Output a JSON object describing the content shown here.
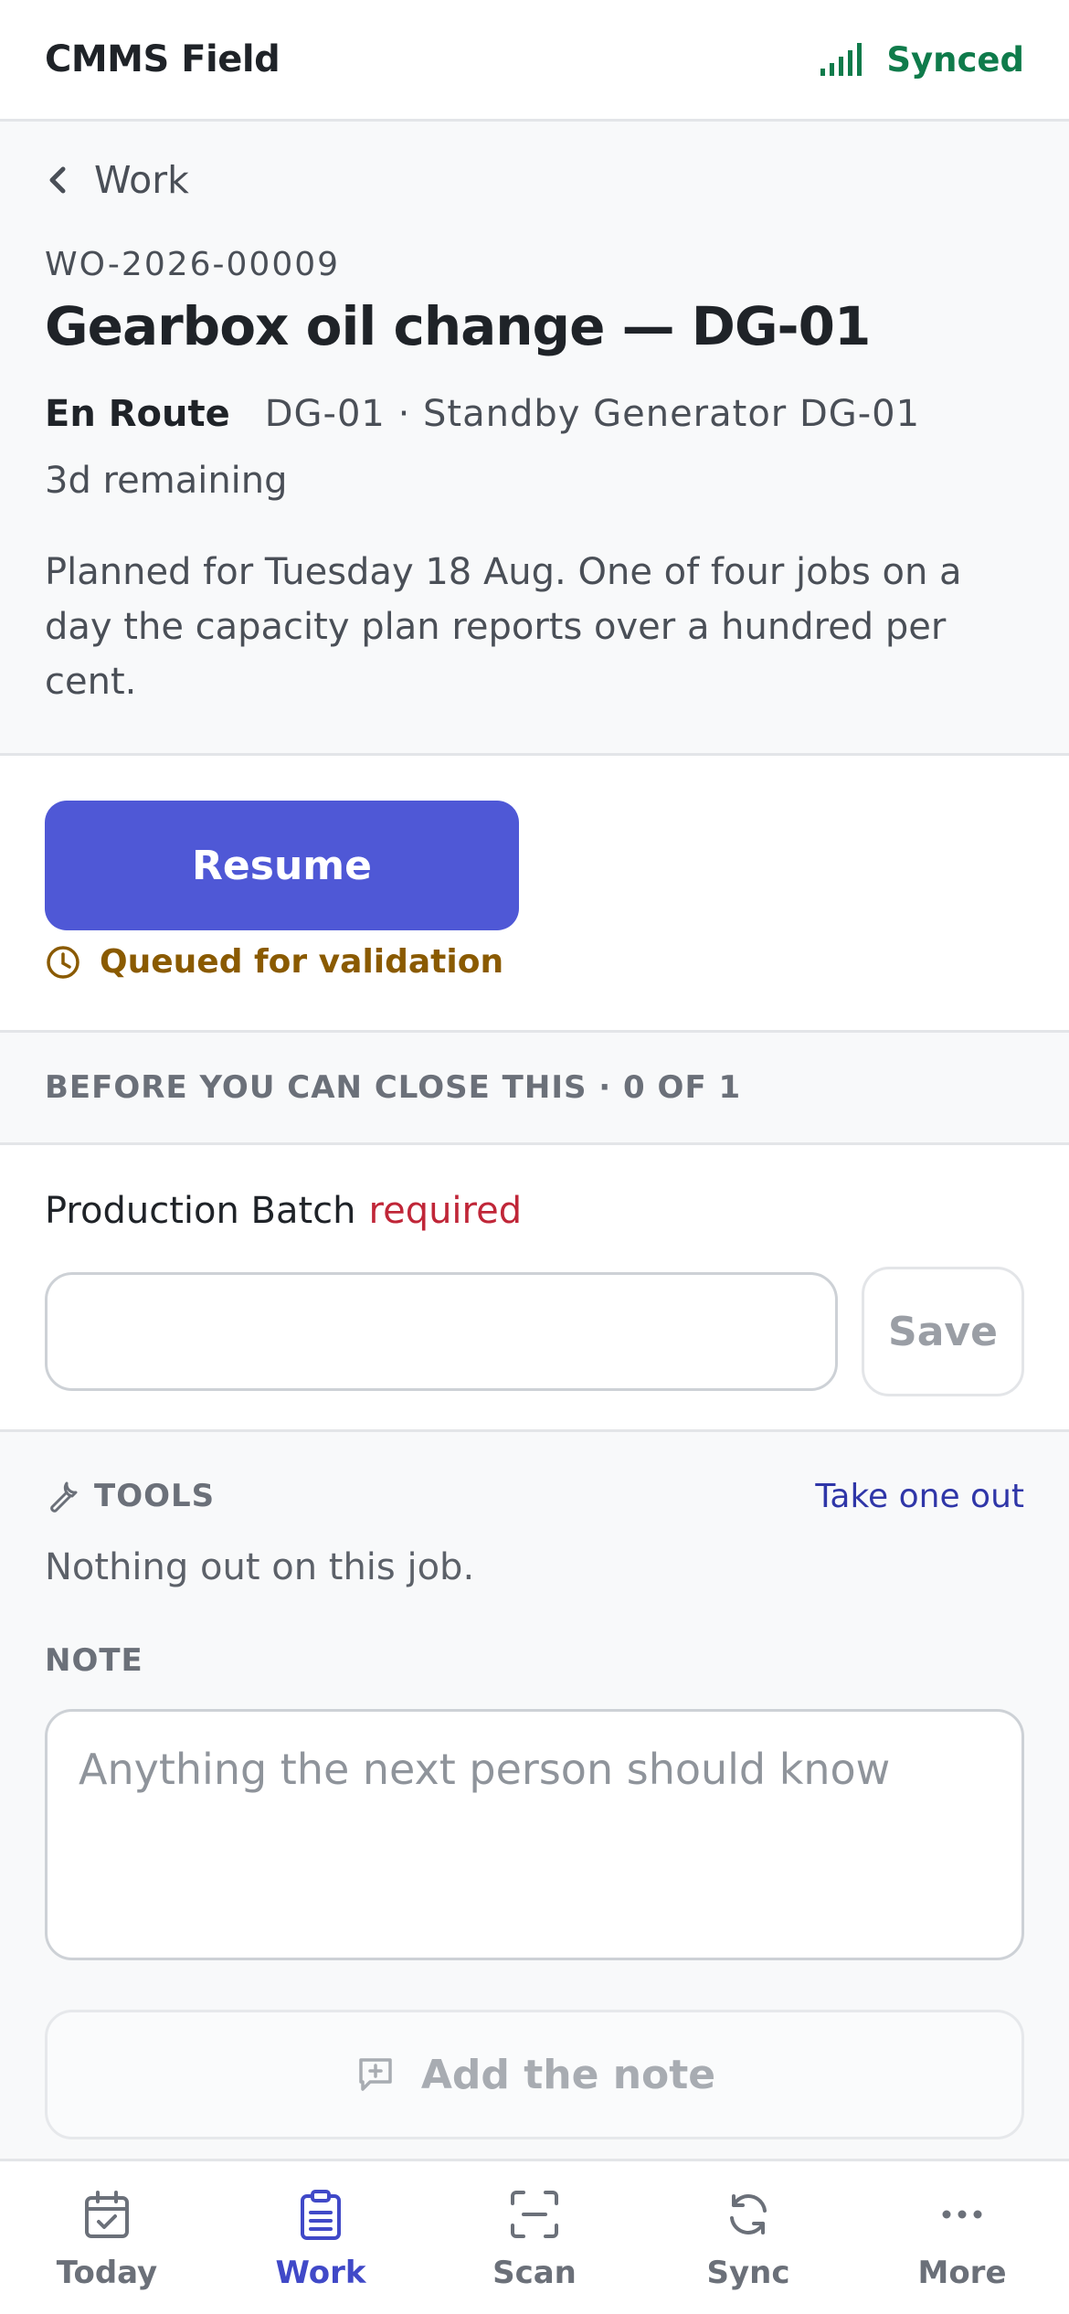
{
  "topbar": {
    "app_title": "CMMS Field",
    "sync_status": "Synced",
    "signal_icon": "signal-bars-icon",
    "sync_color": "#0f7b4b"
  },
  "header": {
    "back_label": "Work",
    "wo_number": "WO-2026-00009",
    "title": "Gearbox oil change — DG-01",
    "status": "En Route",
    "asset": "DG-01 · Standby Generator DG-01",
    "remaining": "3d remaining",
    "description": "Planned for Tuesday 18 Aug. One of four jobs on a day the capacity plan reports over a hundred per cent."
  },
  "action": {
    "resume_label": "Resume",
    "queued_text": "Queued for validation",
    "accent_color": "#4f58d6",
    "queued_color": "#8a5a00"
  },
  "checklist": {
    "header": "BEFORE YOU CAN CLOSE THIS · 0 OF 1"
  },
  "batch": {
    "label": "Production Batch",
    "required": "required",
    "value": "",
    "save_label": "Save"
  },
  "tools": {
    "header": "TOOLS",
    "take_out_label": "Take one out",
    "empty_text": "Nothing out on this job."
  },
  "note": {
    "header": "NOTE",
    "placeholder": "Anything the next person should know",
    "add_label": "Add the note"
  },
  "nav": {
    "items": [
      {
        "label": "Today",
        "icon": "calendar-check-icon"
      },
      {
        "label": "Work",
        "icon": "clipboard-list-icon"
      },
      {
        "label": "Scan",
        "icon": "scan-icon"
      },
      {
        "label": "Sync",
        "icon": "refresh-icon"
      },
      {
        "label": "More",
        "icon": "more-dots-icon"
      }
    ],
    "active": "Work"
  }
}
